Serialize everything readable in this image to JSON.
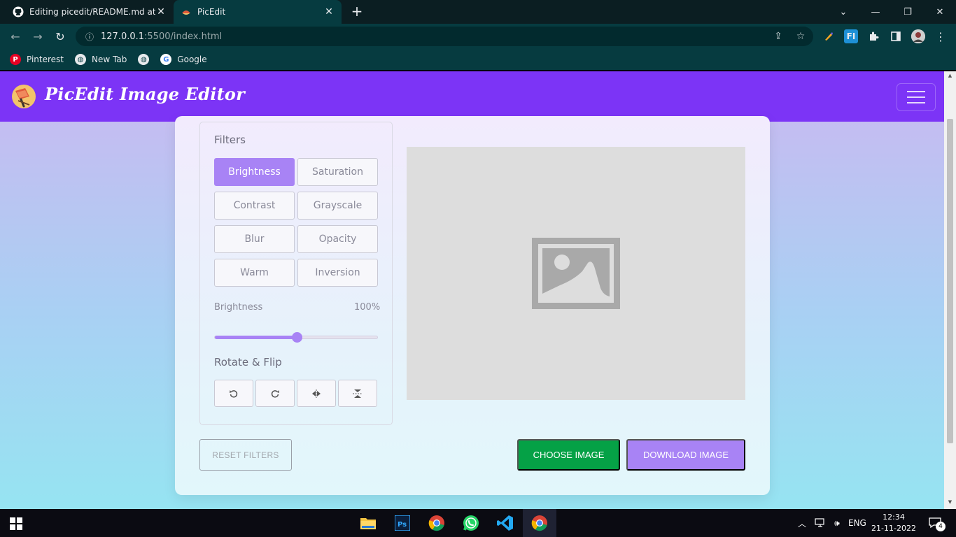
{
  "browser": {
    "tabs": [
      {
        "title": "Editing picedit/README.md at m",
        "icon": "github-icon"
      },
      {
        "title": "PicEdit",
        "icon": "picedit-favicon-icon",
        "active": true
      }
    ],
    "address": {
      "host": "127.0.0.1",
      "path": ":5500/index.html"
    },
    "bookmarks": [
      {
        "label": "Pinterest",
        "icon": "pinterest-icon"
      },
      {
        "label": "New Tab",
        "icon": "globe-icon"
      },
      {
        "label": "",
        "icon": "globe-icon"
      },
      {
        "label": "Google",
        "icon": "google-icon"
      }
    ]
  },
  "app": {
    "brand": "PicEdit Image Editor",
    "filters_title": "Filters",
    "filters": [
      "Brightness",
      "Saturation",
      "Contrast",
      "Grayscale",
      "Blur",
      "Opacity",
      "Warm",
      "Inversion"
    ],
    "active_filter": "Brightness",
    "slider": {
      "name": "Brightness",
      "value_text": "100%",
      "value": 0.5
    },
    "rotate_title": "Rotate & Flip",
    "rotate_buttons": [
      "rotate-left-icon",
      "rotate-right-icon",
      "flip-horizontal-icon",
      "flip-vertical-icon"
    ],
    "reset_label": "RESET FILTERS",
    "choose_label": "CHOOSE IMAGE",
    "download_label": "DOWNLOAD IMAGE"
  },
  "taskbar": {
    "apps": [
      "file-explorer-icon",
      "photoshop-icon",
      "chrome-icon",
      "whatsapp-icon",
      "vscode-icon",
      "chrome-icon"
    ],
    "language": "ENG",
    "time": "12:34",
    "date": "21-11-2022",
    "notifications": "4"
  },
  "colors": {
    "accent": "#7c34f6",
    "filter_active": "#a883f5",
    "choose_button": "#05a146"
  }
}
